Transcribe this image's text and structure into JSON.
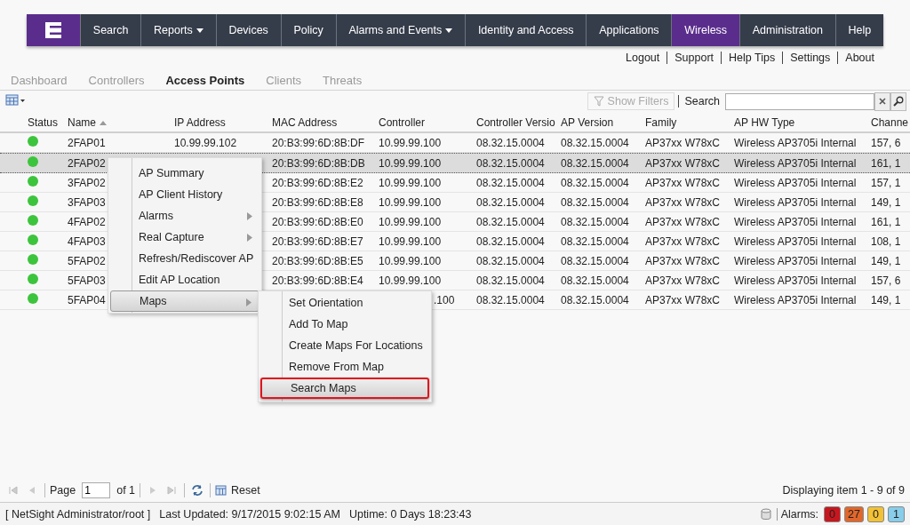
{
  "nav": {
    "items": [
      {
        "label": "Search",
        "selected": false,
        "dropdown": false
      },
      {
        "label": "Reports",
        "selected": false,
        "dropdown": true
      },
      {
        "label": "Devices",
        "selected": false,
        "dropdown": false
      },
      {
        "label": "Policy",
        "selected": false,
        "dropdown": false
      },
      {
        "label": "Alarms and Events",
        "selected": false,
        "dropdown": true
      },
      {
        "label": "Identity and Access",
        "selected": false,
        "dropdown": false
      },
      {
        "label": "Applications",
        "selected": false,
        "dropdown": false
      },
      {
        "label": "Wireless",
        "selected": true,
        "dropdown": false
      },
      {
        "label": "Administration",
        "selected": false,
        "dropdown": false
      },
      {
        "label": "Help",
        "selected": false,
        "dropdown": false
      }
    ]
  },
  "user_links": [
    "Logout",
    "Support",
    "Help Tips",
    "Settings",
    "About"
  ],
  "tabs": [
    {
      "label": "Dashboard",
      "selected": false
    },
    {
      "label": "Controllers",
      "selected": false
    },
    {
      "label": "Access Points",
      "selected": true
    },
    {
      "label": "Clients",
      "selected": false
    },
    {
      "label": "Threats",
      "selected": false
    }
  ],
  "toolbar": {
    "show_filters": {
      "label": "Show Filters",
      "disabled": true
    },
    "search_label": "Search"
  },
  "table": {
    "columns": [
      "Status",
      "Name",
      "IP Address",
      "MAC Address",
      "Controller",
      "Controller Versio",
      "AP Version",
      "Family",
      "AP HW Type",
      "Channe"
    ],
    "rows": [
      {
        "color": "#3dc43d",
        "selected": false,
        "name": "2FAP01",
        "ip": "10.99.99.102",
        "mac": "20:B3:99:6D:8B:DF",
        "controller": "10.99.99.100",
        "controller_version": "08.32.15.0004",
        "ap_version": "08.32.15.0004",
        "family": "AP37xx W78xC",
        "hw_type": "Wireless AP3705i Internal",
        "channel": "157, 6"
      },
      {
        "color": "#3dc43d",
        "selected": true,
        "name": "2FAP02",
        "mac": "20:B3:99:6D:8B:DB",
        "controller": "10.99.99.100",
        "controller_version": "08.32.15.0004",
        "ap_version": "08.32.15.0004",
        "family": "AP37xx W78xC",
        "hw_type": "Wireless AP3705i Internal",
        "channel": "161, 1"
      },
      {
        "color": "#3dc43d",
        "selected": false,
        "name": "3FAP02",
        "mac": "20:B3:99:6D:8B:E2",
        "controller": "10.99.99.100",
        "controller_version": "08.32.15.0004",
        "ap_version": "08.32.15.0004",
        "family": "AP37xx W78xC",
        "hw_type": "Wireless AP3705i Internal",
        "channel": "157, 1"
      },
      {
        "color": "#3dc43d",
        "selected": false,
        "name": "3FAP03",
        "mac": "20:B3:99:6D:8B:E8",
        "controller": "10.99.99.100",
        "controller_version": "08.32.15.0004",
        "ap_version": "08.32.15.0004",
        "family": "AP37xx W78xC",
        "hw_type": "Wireless AP3705i Internal",
        "channel": "149, 1"
      },
      {
        "color": "#3dc43d",
        "selected": false,
        "name": "4FAP02",
        "mac": "20:B3:99:6D:8B:E0",
        "controller": "10.99.99.100",
        "controller_version": "08.32.15.0004",
        "ap_version": "08.32.15.0004",
        "family": "AP37xx W78xC",
        "hw_type": "Wireless AP3705i Internal",
        "channel": "161, 1"
      },
      {
        "color": "#3dc43d",
        "selected": false,
        "name": "4FAP03",
        "mac": "20:B3:99:6D:8B:E7",
        "controller": "10.99.99.100",
        "controller_version": "08.32.15.0004",
        "ap_version": "08.32.15.0004",
        "family": "AP37xx W78xC",
        "hw_type": "Wireless AP3705i Internal",
        "channel": "108, 1"
      },
      {
        "color": "#3dc43d",
        "selected": false,
        "name": "5FAP02",
        "mac": "20:B3:99:6D:8B:E5",
        "controller": "10.99.99.100",
        "controller_version": "08.32.15.0004",
        "ap_version": "08.32.15.0004",
        "family": "AP37xx W78xC",
        "hw_type": "Wireless AP3705i Internal",
        "channel": "149, 1"
      },
      {
        "color": "#3dc43d",
        "selected": false,
        "name": "5FAP03",
        "mac": "20:B3:99:6D:8B:E4",
        "controller": "10.99.99.100",
        "controller_version": "08.32.15.0004",
        "ap_version": "08.32.15.0004",
        "family": "AP37xx W78xC",
        "hw_type": "Wireless AP3705i Internal",
        "channel": "157, 6"
      },
      {
        "color": "#3dc43d",
        "selected": false,
        "name": "5FAP04",
        "controller": ".100",
        "controller_version": "08.32.15.0004",
        "ap_version": "08.32.15.0004",
        "family": "AP37xx W78xC",
        "hw_type": "Wireless AP3705i Internal",
        "channel": "149, 1"
      }
    ]
  },
  "context_menu": {
    "items": [
      {
        "label": "AP Summary",
        "submenu": false,
        "selected": false
      },
      {
        "label": "AP Client History",
        "submenu": false,
        "selected": false
      },
      {
        "label": "Alarms",
        "submenu": true,
        "selected": false
      },
      {
        "label": "Real Capture",
        "submenu": true,
        "selected": false
      },
      {
        "label": "Refresh/Rediscover AP",
        "submenu": false,
        "selected": false
      },
      {
        "label": "Edit AP Location",
        "submenu": false,
        "selected": false
      },
      {
        "label": "Maps",
        "submenu": true,
        "selected": true
      }
    ]
  },
  "submenu": {
    "items": [
      {
        "label": "Set Orientation",
        "highlighted": false
      },
      {
        "label": "Add To Map",
        "highlighted": false
      },
      {
        "label": "Create Maps For Locations",
        "highlighted": false
      },
      {
        "label": "Remove From Map",
        "highlighted": false
      },
      {
        "label": "Search Maps",
        "highlighted": true
      }
    ]
  },
  "pager": {
    "page_label": "Page",
    "page": "1",
    "of": "of 1",
    "reset": "Reset",
    "display": "Displaying item 1 - 9 of 9"
  },
  "status_bar": {
    "user": "[ NetSight Administrator/root ]",
    "updated": "Last Updated: 9/17/2015 9:02:15 AM",
    "uptime": "Uptime: 0 Days 18:23:43",
    "alarms_label": "Alarms:",
    "alarms": [
      {
        "count": "0",
        "color": "#c8161e"
      },
      {
        "count": "27",
        "color": "#e2662a"
      },
      {
        "count": "0",
        "color": "#f2c136"
      },
      {
        "count": "1",
        "color": "#88cdea"
      }
    ]
  }
}
